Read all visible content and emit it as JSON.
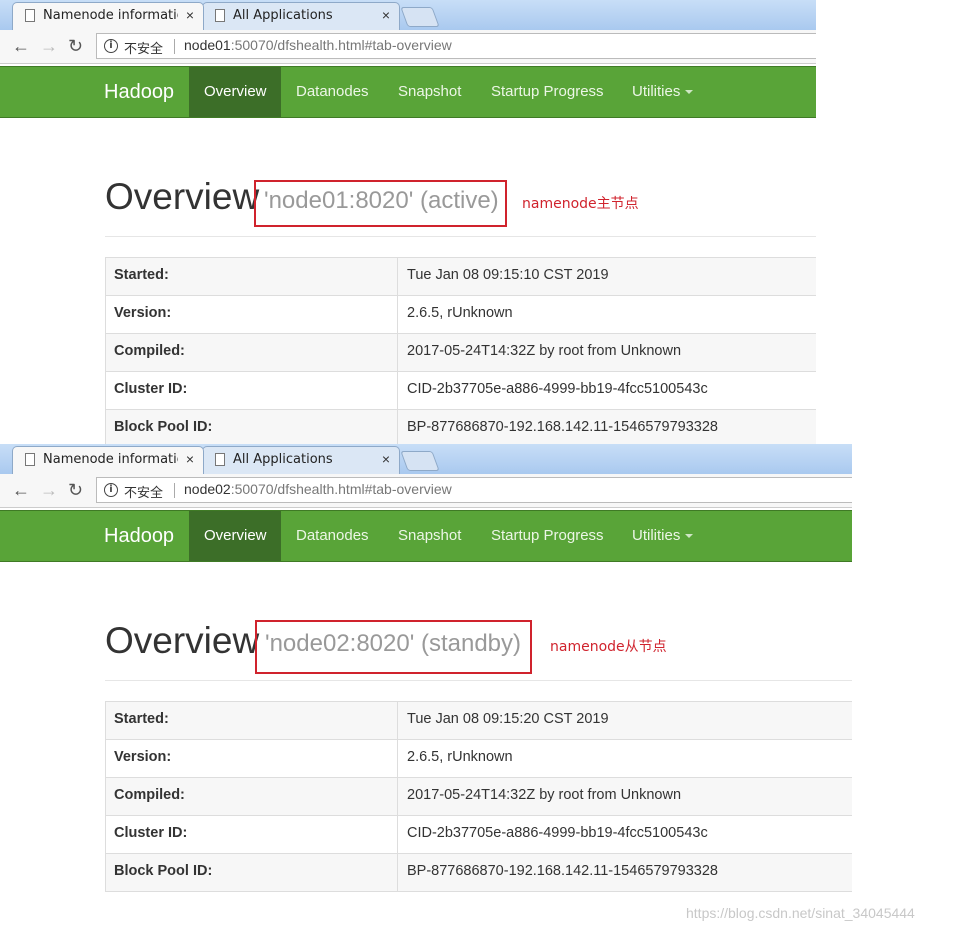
{
  "screens": [
    {
      "tabs": [
        {
          "title": "Namenode information",
          "close": "×"
        },
        {
          "title": "All Applications",
          "close": "×"
        }
      ],
      "address": {
        "insecure_label": "不安全",
        "url_host": "node01",
        "url_rest": ":50070/dfshealth.html#tab-overview"
      },
      "navbar": {
        "brand": "Hadoop",
        "items": [
          "Overview",
          "Datanodes",
          "Snapshot",
          "Startup Progress",
          "Utilities"
        ],
        "active_index": 0
      },
      "heading": "Overview",
      "host": "'node01:8020' (active)",
      "annotation": "namenode主节点",
      "rows": [
        {
          "label": "Started:",
          "value": "Tue Jan 08 09:15:10 CST 2019"
        },
        {
          "label": "Version:",
          "value": "2.6.5, rUnknown"
        },
        {
          "label": "Compiled:",
          "value": "2017-05-24T14:32Z by root from Unknown"
        },
        {
          "label": "Cluster ID:",
          "value": "CID-2b37705e-a886-4999-bb19-4fcc5100543c"
        },
        {
          "label": "Block Pool ID:",
          "value": "BP-877686870-192.168.142.11-1546579793328"
        }
      ]
    },
    {
      "tabs": [
        {
          "title": "Namenode information",
          "close": "×"
        },
        {
          "title": "All Applications",
          "close": "×"
        }
      ],
      "address": {
        "insecure_label": "不安全",
        "url_host": "node02",
        "url_rest": ":50070/dfshealth.html#tab-overview"
      },
      "navbar": {
        "brand": "Hadoop",
        "items": [
          "Overview",
          "Datanodes",
          "Snapshot",
          "Startup Progress",
          "Utilities"
        ],
        "active_index": 0
      },
      "heading": "Overview",
      "host": "'node02:8020' (standby)",
      "annotation": "namenode从节点",
      "rows": [
        {
          "label": "Started:",
          "value": "Tue Jan 08 09:15:20 CST 2019"
        },
        {
          "label": "Version:",
          "value": "2.6.5, rUnknown"
        },
        {
          "label": "Compiled:",
          "value": "2017-05-24T14:32Z by root from Unknown"
        },
        {
          "label": "Cluster ID:",
          "value": "CID-2b37705e-a886-4999-bb19-4fcc5100543c"
        },
        {
          "label": "Block Pool ID:",
          "value": "BP-877686870-192.168.142.11-1546579793328"
        }
      ]
    }
  ],
  "watermark": "https://blog.csdn.net/sinat_34045444",
  "colors": {
    "navbar": "#59a438",
    "navbar_active": "#3c6e28",
    "highlight": "#d0232d"
  }
}
